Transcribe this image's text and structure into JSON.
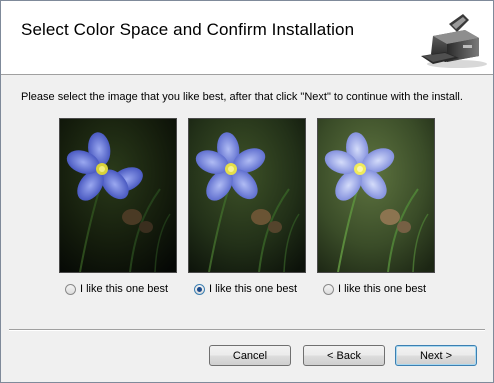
{
  "dialog": {
    "title": "Select Color Space and Confirm Installation",
    "instruction": "Please select the image that you like best, after that click \"Next\" to continue with the install.",
    "icon": "scanner-icon"
  },
  "options": [
    {
      "label": "I like this one best",
      "selected": false
    },
    {
      "label": "I like this one best",
      "selected": true
    },
    {
      "label": "I like this one best",
      "selected": false
    }
  ],
  "buttons": {
    "cancel": "Cancel",
    "back": "< Back",
    "next": "Next >"
  }
}
